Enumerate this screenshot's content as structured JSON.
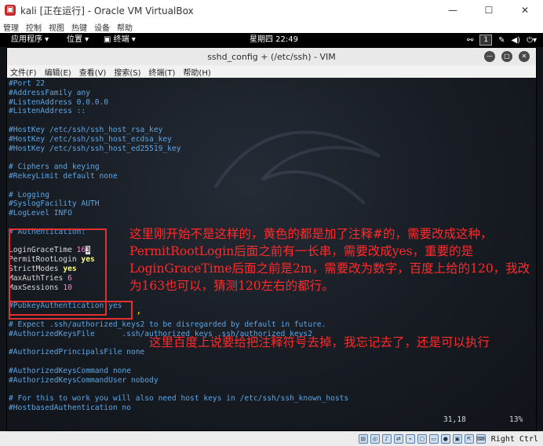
{
  "window": {
    "icon": "virtualbox-icon",
    "title": "kali [正在运行] - Oracle VM VirtualBox",
    "controls": [
      "—",
      "☐",
      "✕"
    ]
  },
  "vb_menu": [
    "管理",
    "控制",
    "视图",
    "热键",
    "设备",
    "帮助"
  ],
  "gnome_panel": {
    "apps": "应用程序 ▾",
    "places": "位置 ▾",
    "terminal": "▣ 终端 ▾",
    "clock": "星期四 22:49",
    "workspace": "1"
  },
  "terminal": {
    "title": "sshd_config + (/etc/ssh) - VIM",
    "menu": [
      "文件(F)",
      "编辑(E)",
      "查看(V)",
      "搜索(S)",
      "终端(T)",
      "帮助(H)"
    ],
    "status_pos": "31,18",
    "status_pct": "13%"
  },
  "code_lines": [
    {
      "text": "#Port 22",
      "cls": ""
    },
    {
      "text": "#AddressFamily any",
      "cls": ""
    },
    {
      "text": "#ListenAddress 0.0.0.0",
      "cls": ""
    },
    {
      "text": "#ListenAddress ::",
      "cls": ""
    },
    {
      "text": "",
      "cls": ""
    },
    {
      "text": "#HostKey /etc/ssh/ssh_host_rsa_key",
      "cls": ""
    },
    {
      "text": "#HostKey /etc/ssh/ssh_host_ecdsa_key",
      "cls": ""
    },
    {
      "text": "#HostKey /etc/ssh/ssh_host_ed25519_key",
      "cls": ""
    },
    {
      "text": "",
      "cls": ""
    },
    {
      "text": "# Ciphers and keying",
      "cls": ""
    },
    {
      "text": "#RekeyLimit default none",
      "cls": ""
    },
    {
      "text": "",
      "cls": ""
    },
    {
      "text": "# Logging",
      "cls": ""
    },
    {
      "text": "#SyslogFacility AUTH",
      "cls": ""
    },
    {
      "text": "#LogLevel INFO",
      "cls": ""
    },
    {
      "text": "",
      "cls": ""
    },
    {
      "text": "# Authentication:",
      "cls": ""
    },
    {
      "text": "",
      "cls": ""
    },
    {
      "text": "",
      "cls": "special",
      "parts": [
        {
          "t": "LoginGraceTime ",
          "c": "default"
        },
        {
          "t": "16",
          "c": "num"
        },
        {
          "t": "3",
          "c": "cur"
        }
      ]
    },
    {
      "text": "",
      "cls": "special",
      "parts": [
        {
          "t": "PermitRootLogin ",
          "c": "default"
        },
        {
          "t": "yes",
          "c": "kw"
        }
      ]
    },
    {
      "text": "",
      "cls": "special",
      "parts": [
        {
          "t": "StrictModes ",
          "c": "default"
        },
        {
          "t": "yes",
          "c": "kw"
        }
      ]
    },
    {
      "text": "",
      "cls": "special",
      "parts": [
        {
          "t": "MaxAuthTries ",
          "c": "default"
        },
        {
          "t": "6",
          "c": "num"
        }
      ]
    },
    {
      "text": "",
      "cls": "special",
      "parts": [
        {
          "t": "MaxSessions ",
          "c": "default"
        },
        {
          "t": "10",
          "c": "num"
        }
      ]
    },
    {
      "text": "",
      "cls": ""
    },
    {
      "text": "#PubkeyAuthentication yes",
      "cls": ""
    },
    {
      "text": "",
      "cls": ""
    },
    {
      "text": "# Expect .ssh/authorized_keys2 to be disregarded by default in future.",
      "cls": ""
    },
    {
      "text": "#AuthorizedKeysFile      .ssh/authorized_keys .ssh/authorized_keys2",
      "cls": ""
    },
    {
      "text": "",
      "cls": ""
    },
    {
      "text": "#AuthorizedPrincipalsFile none",
      "cls": ""
    },
    {
      "text": "",
      "cls": ""
    },
    {
      "text": "#AuthorizedKeysCommand none",
      "cls": ""
    },
    {
      "text": "#AuthorizedKeysCommandUser nobody",
      "cls": ""
    },
    {
      "text": "",
      "cls": ""
    },
    {
      "text": "# For this to work you will also need host keys in /etc/ssh/ssh_known_hosts",
      "cls": ""
    },
    {
      "text": "#HostbasedAuthentication no",
      "cls": ""
    }
  ],
  "annotations": {
    "note1": "这里刚开始不是这样的，黄色的都是加了注释#的，需要改成这种，PermitRootLogin后面之前有一长串，需要改成yes，重要的是LoginGraceTime后面之前是2m，需要改为数字，百度上给的120，我改为163也可以，猜测120左右的都行。",
    "note2": "这里百度上说要给把注释符号去掉，我忘记去了，还是可以执行",
    "tick": ","
  },
  "statusbar": {
    "host_key": "Right Ctrl",
    "icons": [
      "hdd-icon",
      "optical-icon",
      "audio-icon",
      "network-icon",
      "usb-icon",
      "shared-folder-icon",
      "display-icon",
      "recording-icon",
      "cpu-icon",
      "mouse-integration-icon",
      "keyboard-icon"
    ]
  }
}
